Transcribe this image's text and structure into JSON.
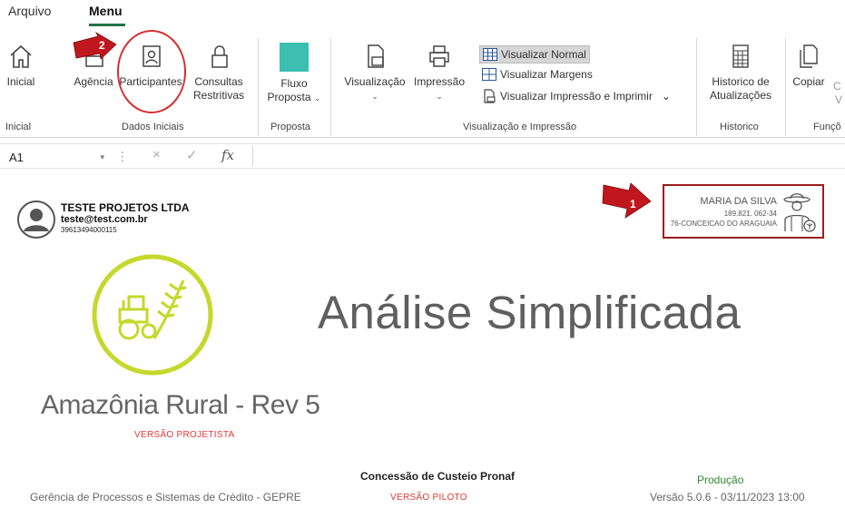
{
  "ribbon": {
    "tabs": [
      "Arquivo",
      "Menu"
    ],
    "buttons": {
      "inicial": "Inicial",
      "agencia": "Agência",
      "participantes": "Participantes",
      "consultas_l1": "Consultas",
      "consultas_l2": "Restritivas",
      "fluxo_l1": "Fluxo",
      "fluxo_l2": "Proposta",
      "visualizacao": "Visualização",
      "impressao": "Impressão",
      "historico_l1": "Historico de",
      "historico_l2": "Atualizações",
      "copiar": "Copiar",
      "partial_c": "C",
      "partial_v": "V"
    },
    "view_options": {
      "normal": "Visualizar Normal",
      "margens": "Visualizar Margens",
      "imprimir": "Visualizar Impressão e Imprimir"
    },
    "groups": {
      "inicial": "Inicial",
      "dados_iniciais": "Dados Iniciais",
      "proposta": "Proposta",
      "visualizacao_impressao": "Visualização e Impressão",
      "historico": "Historico",
      "funcoes": "Funçõ"
    },
    "callouts": [
      "1",
      "2"
    ],
    "colors": {
      "fluxo_square": "#3cbfb1",
      "callout_red": "#c0161d",
      "highlight_circle": "#d32f2f"
    }
  },
  "formula_bar": {
    "name_box": "A1",
    "fx": "fx",
    "cancel": "×",
    "confirm": "✓"
  },
  "sheet": {
    "company": {
      "name": "TESTE PROJETOS LTDA",
      "email": "teste@test.com.br",
      "id": "39613494000115"
    },
    "user": {
      "name": "MARIA DA SILVA",
      "cpf": "189.821. 062-34",
      "city": "76-CONCEICAO DO ARAGUAIA"
    },
    "title": "Análise Simplificada",
    "product": "Amazônia Rural - Rev 5",
    "version_label": "VERSÃO PROJETISTA",
    "concessao": "Concessão de Custeio Pronaf",
    "producao": "Produção",
    "gerencia": "Gerência de Processos e Sistemas de Crédito - GEPRE",
    "piloto": "VERSÃO PILOTO",
    "versao": "Versão 5.0.6 - 03/11/2023 13:00",
    "colors": {
      "logo_green": "#c5d82c",
      "red_text": "#e53935",
      "green_text": "#2e8b2e"
    }
  }
}
